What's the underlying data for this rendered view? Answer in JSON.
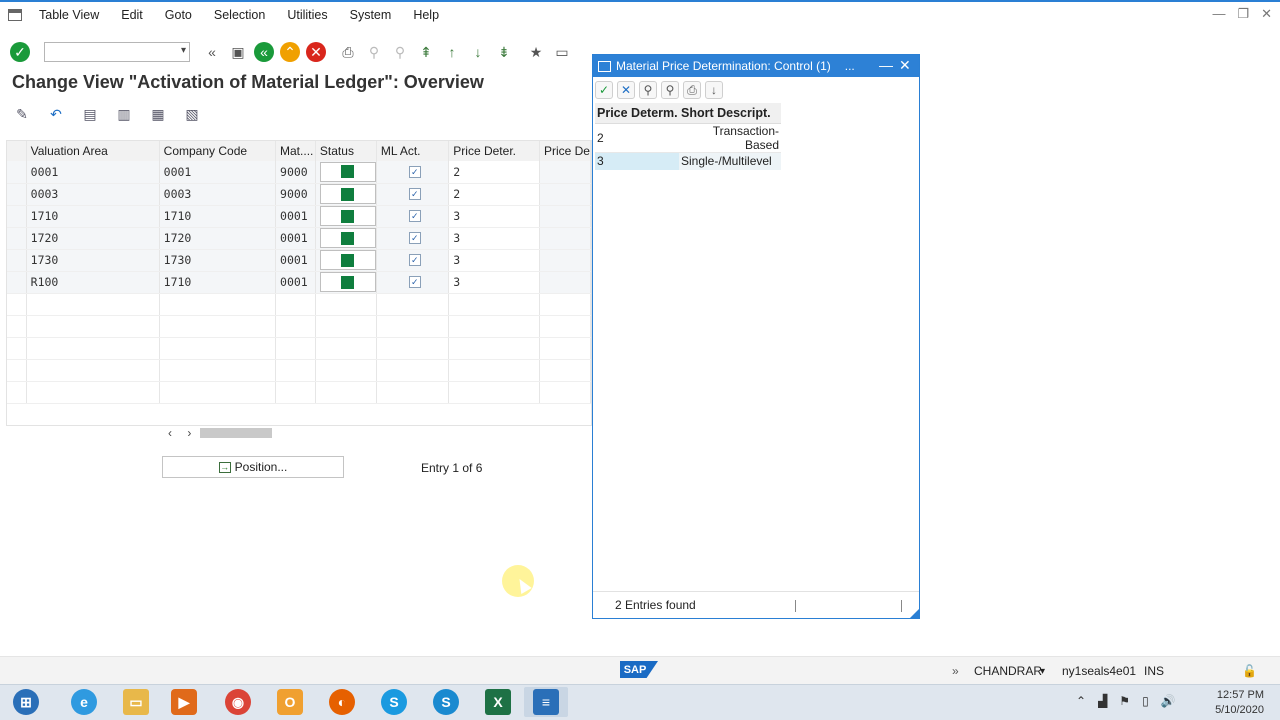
{
  "menu": {
    "items": [
      "Table View",
      "Edit",
      "Goto",
      "Selection",
      "Utilities",
      "System",
      "Help"
    ]
  },
  "page": {
    "title": "Change View \"Activation of Material Ledger\": Overview"
  },
  "table": {
    "columns": [
      "Valuation Area",
      "Company Code",
      "Mat....",
      "Status",
      "ML Act.",
      "Price Deter.",
      "Price De"
    ],
    "rows": [
      {
        "valuation_area": "0001",
        "company_code": "0001",
        "mat": "9000",
        "ml_act": true,
        "price_deter": "2"
      },
      {
        "valuation_area": "0003",
        "company_code": "0003",
        "mat": "9000",
        "ml_act": true,
        "price_deter": "2"
      },
      {
        "valuation_area": "1710",
        "company_code": "1710",
        "mat": "0001",
        "ml_act": true,
        "price_deter": "3"
      },
      {
        "valuation_area": "1720",
        "company_code": "1720",
        "mat": "0001",
        "ml_act": true,
        "price_deter": "3"
      },
      {
        "valuation_area": "1730",
        "company_code": "1730",
        "mat": "0001",
        "ml_act": true,
        "price_deter": "3"
      },
      {
        "valuation_area": "R100",
        "company_code": "1710",
        "mat": "0001",
        "ml_act": true,
        "price_deter": "3"
      }
    ],
    "status_color": "#0f7e3e"
  },
  "footer": {
    "position_label": "Position...",
    "entry_text": "Entry 1 of 6"
  },
  "popup": {
    "title": "Material Price Determination: Control (1)",
    "more": "...",
    "columns": [
      "Price Determ.",
      "Short Descript."
    ],
    "rows": [
      {
        "code": "2",
        "desc": "Transaction-Based"
      },
      {
        "code": "3",
        "desc": "Single-/Multilevel"
      }
    ],
    "status": "2 Entries found"
  },
  "statusbar": {
    "logo": "SAP",
    "user": "CHANDRAR",
    "server": "ny1seals4e01",
    "mode": "INS"
  },
  "taskbar": {
    "time": "12:57 PM",
    "date": "5/10/2020"
  },
  "colors": {
    "accent": "#2d81d6",
    "ok_green": "#1a9a3a",
    "cancel_red": "#d9261c"
  }
}
